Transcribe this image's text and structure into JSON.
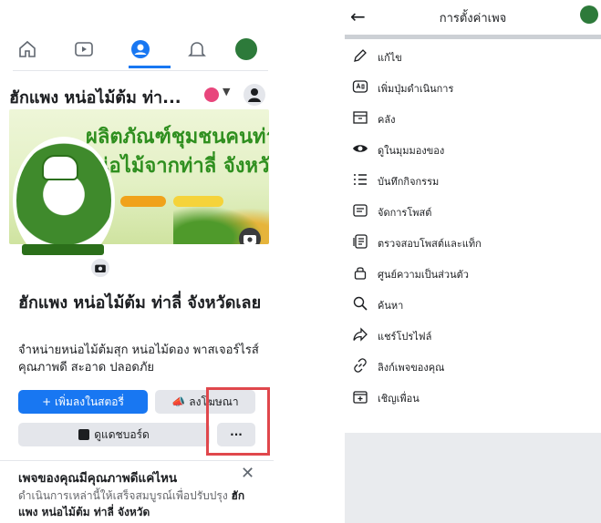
{
  "left": {
    "tabs": [
      {
        "name": "home",
        "icon": "home-icon"
      },
      {
        "name": "watch",
        "icon": "video-icon"
      },
      {
        "name": "pages",
        "icon": "profile-circle-icon",
        "active": true
      },
      {
        "name": "notifications",
        "icon": "bell-icon"
      },
      {
        "name": "menu",
        "icon": "profile-avatar-icon"
      }
    ],
    "page_header": {
      "title": "ฮักแพง หน่อไม้ต้ม ท่า..."
    },
    "cover": {
      "headline_1": "ผลิตภัณฑ์ชุมชนคนท่าลี่",
      "headline_2": "หน่อไม้จากท่าลี่ จังหวัดเลย"
    },
    "page_name": "ฮักแพง หน่อไม้ต้ม ท่าลี่ จังหวัดเลย",
    "description": "จำหน่ายหน่อไม้ต้มสุก หน่อไม้ดอง พาสเจอร์ไรส์ คุณภาพดี สะอาด ปลอดภัย",
    "buttons": {
      "add_to_story": "+ เพิ่มลงในสตอรี่",
      "advertise": "ลงโฆษณา",
      "dashboard": "ดูแดชบอร์ด",
      "more": "···"
    },
    "tip": {
      "title": "เพจของคุณมีคุณภาพดีแค่ไหน",
      "body_prefix": "ดำเนินการเหล่านี้ให้เสร็จสมบูรณ์เพื่อปรับปรุง ",
      "body_bold": "ฮักแพง หน่อไม้ต้ม ท่าลี่ จังหวัด"
    }
  },
  "right": {
    "title": "การตั้งค่าเพจ",
    "menu": [
      {
        "label": "แก้ไข",
        "icon": "pencil-icon"
      },
      {
        "label": "เพิ่มปุ่มดำเนินการ",
        "icon": "action-button-icon"
      },
      {
        "label": "คลัง",
        "icon": "archive-icon"
      },
      {
        "label": "ดูในมุมมองของ",
        "icon": "eye-icon"
      },
      {
        "label": "บันทึกกิจกรรม",
        "icon": "activity-list-icon"
      },
      {
        "label": "จัดการโพสต์",
        "icon": "manage-posts-icon"
      },
      {
        "label": "ตรวจสอบโพสต์และแท็ก",
        "icon": "review-tags-icon"
      },
      {
        "label": "ศูนย์ความเป็นส่วนตัว",
        "icon": "lock-icon"
      },
      {
        "label": "ค้นหา",
        "icon": "search-icon"
      },
      {
        "label": "แชร์โปรไฟล์",
        "icon": "share-icon"
      },
      {
        "label": "ลิงก์เพจของคุณ",
        "icon": "link-icon"
      },
      {
        "label": "เชิญเพื่อน",
        "icon": "invite-friends-icon"
      }
    ]
  },
  "colors": {
    "primary": "#1877f2",
    "highlight": "#e0474c",
    "panel_gray": "#e9ebee"
  }
}
